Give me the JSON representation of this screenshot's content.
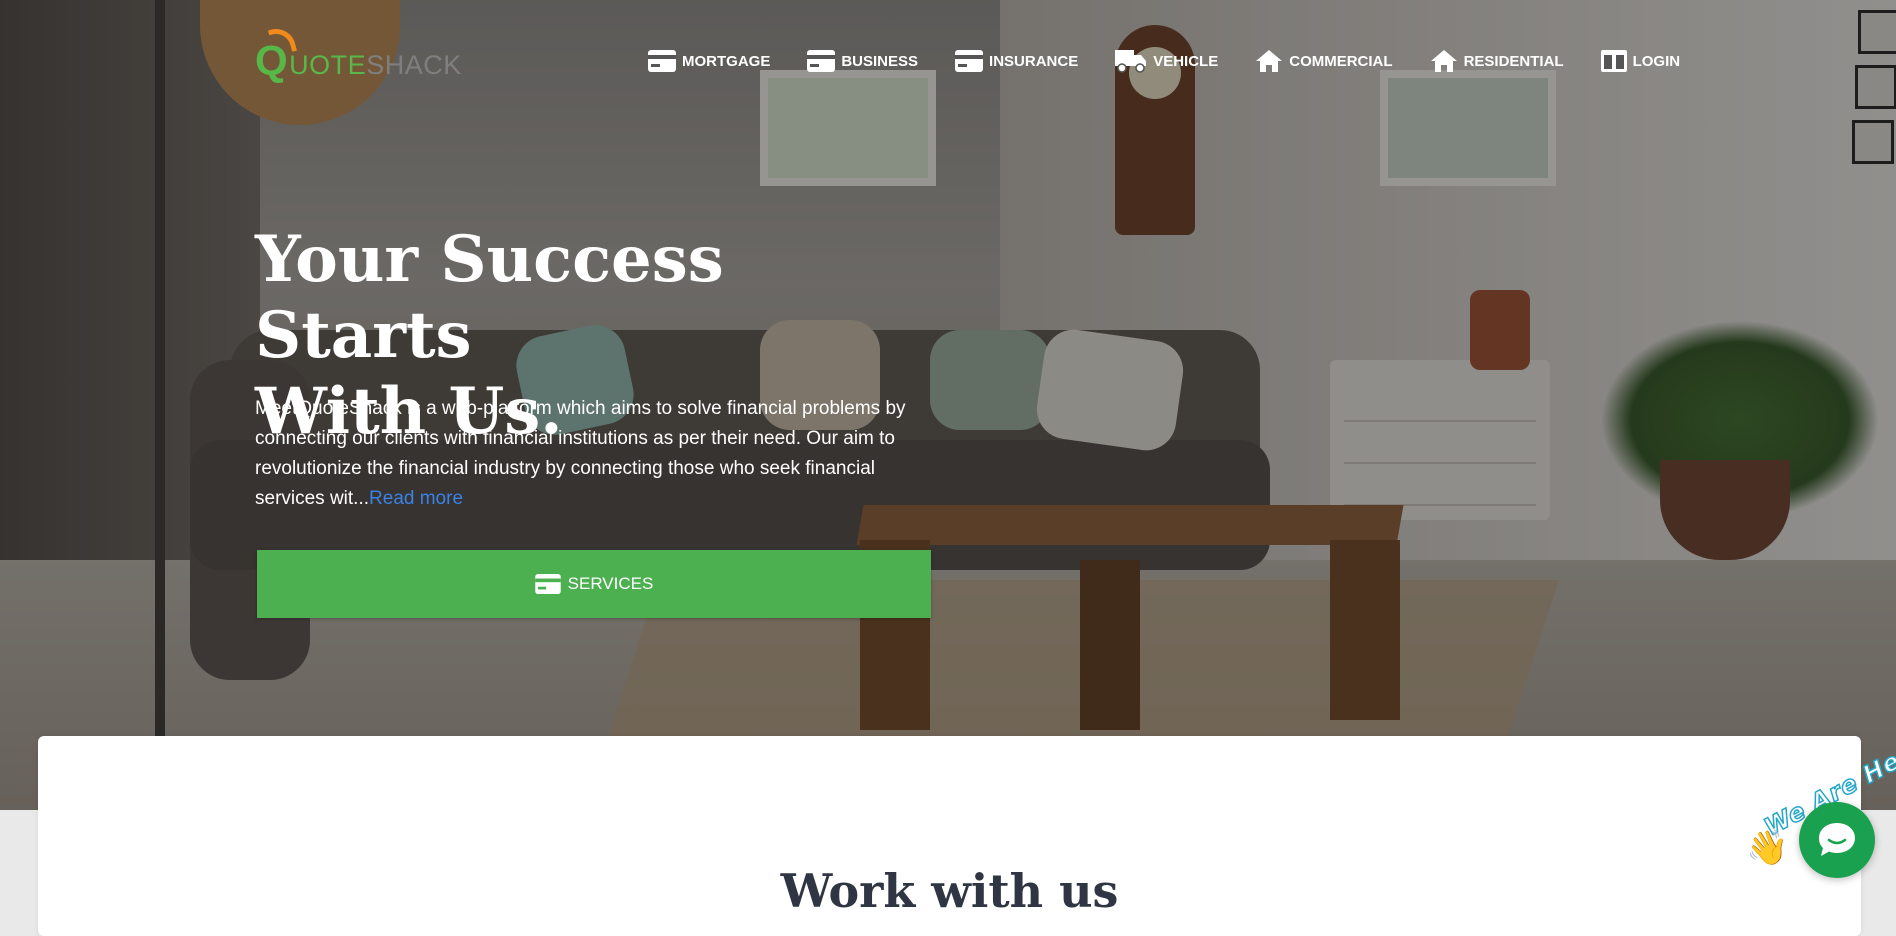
{
  "brand": {
    "logo_q": "Q",
    "logo_uote": "UOTE",
    "logo_shack": "SHACK"
  },
  "nav": {
    "items": [
      {
        "label": "MORTGAGE",
        "icon": "credit-card-icon"
      },
      {
        "label": "BUSINESS",
        "icon": "credit-card-icon"
      },
      {
        "label": "INSURANCE",
        "icon": "credit-card-icon"
      },
      {
        "label": "VEHICLE",
        "icon": "truck-icon"
      },
      {
        "label": "COMMERCIAL",
        "icon": "home-icon"
      },
      {
        "label": "RESIDENTIAL",
        "icon": "home-icon"
      },
      {
        "label": "LOGIN",
        "icon": "columns-icon"
      }
    ]
  },
  "hero": {
    "title_line1": "Your Success Starts",
    "title_line2": "With Us.",
    "description": "MeetQuoteShack is a web-platform which aims to solve financial problems by connecting our clients with financial institutions as per their need. Our aim to revolutionize the financial industry by connecting those who seek financial services wit...",
    "read_more": "Read more",
    "services_button": "SERVICES"
  },
  "section": {
    "title": "Work with us"
  },
  "chat": {
    "badge": "We Are Here!",
    "wave_emoji": "👋"
  },
  "colors": {
    "brand_green": "#4caf50",
    "logo_orange": "#f08a1c",
    "link_blue": "#3b82e6",
    "chat_green": "#1aa14f"
  }
}
